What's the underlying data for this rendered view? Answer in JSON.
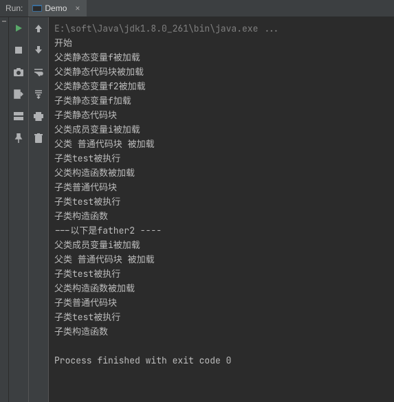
{
  "header": {
    "run_label": "Run:",
    "tab_name": "Demo",
    "tab_close": "×"
  },
  "icons": {
    "rerun": "rerun-icon",
    "stop": "stop-icon",
    "camera": "camera-icon",
    "exit": "exit-icon",
    "layout": "layout-icon",
    "pin": "pin-icon",
    "up": "up-arrow-icon",
    "down": "down-arrow-icon",
    "wrap": "wrap-icon",
    "scroll_end": "scroll-to-end-icon",
    "print": "print-icon",
    "trash": "trash-icon"
  },
  "console": {
    "command": "E:\\soft\\Java\\jdk1.8.0_261\\bin\\java.exe ...",
    "lines": [
      "开始",
      "父类静态变量f被加载",
      "父类静态代码块被加载",
      "  父类静态变量f2被加载",
      "  子类静态变量f加载",
      "  子类静态代码块",
      "父类成员变量i被加载",
      "  父类 普通代码块 被加载",
      "  子类test被执行",
      "父类构造函数被加载",
      "  子类普通代码块",
      "  子类test被执行",
      "  子类构造函数",
      "---以下是father2 ----",
      "父类成员变量i被加载",
      "  父类 普通代码块 被加载",
      "  子类test被执行",
      "父类构造函数被加载",
      "  子类普通代码块",
      "  子类test被执行",
      "  子类构造函数",
      "",
      "Process finished with exit code 0"
    ]
  }
}
